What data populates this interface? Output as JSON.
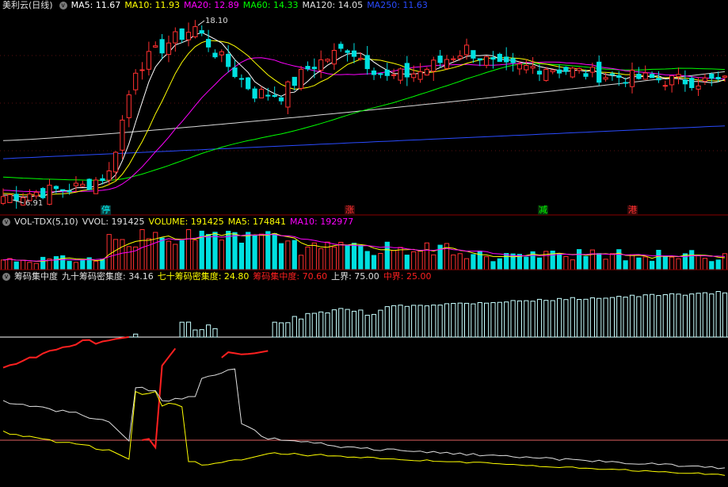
{
  "main_panel": {
    "title": "美利云(日线)",
    "indicators": [
      {
        "label": "MA5: 11.67",
        "color": "#ffffff"
      },
      {
        "label": "MA10: 11.93",
        "color": "#ffff00"
      },
      {
        "label": "MA20: 12.89",
        "color": "#ff00ff"
      },
      {
        "label": "MA60: 14.33",
        "color": "#00ff00"
      },
      {
        "label": "MA120: 14.05",
        "color": "#e0e0e0"
      },
      {
        "label": "MA250: 11.63",
        "color": "#2a4bff"
      }
    ],
    "high_label": "18.10",
    "low_label": "6.91",
    "events": [
      {
        "label": "停",
        "color": "#00ffff"
      },
      {
        "label": "涨",
        "color": "#ff3030"
      },
      {
        "label": "减",
        "color": "#00ff00"
      },
      {
        "label": "港",
        "color": "#ff3030"
      }
    ]
  },
  "volume_panel": {
    "title": "VOL-TDX(5,10)",
    "indicators": [
      {
        "label": "VVOL: 191425",
        "color": "#e0e0e0"
      },
      {
        "label": "VOLUME: 191425",
        "color": "#ffff00"
      },
      {
        "label": "MA5: 174841",
        "color": "#ffff00"
      },
      {
        "label": "MA10: 192977",
        "color": "#ff00ff"
      }
    ]
  },
  "chip_panel": {
    "title": "筹码集中度",
    "indicators": [
      {
        "label": "九十筹码密集度: 34.16",
        "color": "#e0e0e0"
      },
      {
        "label": "七十筹码密集度: 24.80",
        "color": "#ffff00"
      },
      {
        "label": "筹码集中度: 70.60",
        "color": "#ff2020"
      },
      {
        "label": "上界: 75.00",
        "color": "#e0e0e0"
      },
      {
        "label": "中界: 25.00",
        "color": "#ff2020"
      }
    ]
  },
  "colors": {
    "up": "#ff3030",
    "down": "#00e0e0",
    "ma5": "#ffffff",
    "ma10": "#ffff00",
    "ma20": "#ff00ff",
    "ma60": "#00ff00",
    "ma120": "#d8d8d8",
    "ma250": "#2a4bff"
  },
  "chart_data": {
    "type": "candlestick",
    "stock": "美利云",
    "period": "日线",
    "price_extremes": {
      "high": 18.1,
      "low": 6.91
    },
    "bars": 110,
    "close_trend_keypoints": [
      {
        "bar": 0,
        "close": 7.2
      },
      {
        "bar": 12,
        "close": 7.8
      },
      {
        "bar": 16,
        "close": 8.6
      },
      {
        "bar": 20,
        "close": 15.0
      },
      {
        "bar": 25,
        "close": 16.6
      },
      {
        "bar": 29,
        "close": 17.5
      },
      {
        "bar": 32,
        "close": 16.0
      },
      {
        "bar": 38,
        "close": 13.5
      },
      {
        "bar": 42,
        "close": 13.4
      },
      {
        "bar": 46,
        "close": 15.0
      },
      {
        "bar": 52,
        "close": 16.3
      },
      {
        "bar": 58,
        "close": 14.4
      },
      {
        "bar": 63,
        "close": 14.8
      },
      {
        "bar": 70,
        "close": 16.2
      },
      {
        "bar": 75,
        "close": 15.0
      },
      {
        "bar": 82,
        "close": 15.1
      },
      {
        "bar": 90,
        "close": 14.6
      },
      {
        "bar": 100,
        "close": 14.3
      },
      {
        "bar": 109,
        "close": 14.2
      }
    ],
    "chip_levels": {
      "upper": 75.0,
      "middle": 25.0
    },
    "latest": {
      "ma5": 11.67,
      "ma10": 11.93,
      "ma20": 12.89,
      "ma60": 14.33,
      "ma120": 14.05,
      "ma250": 11.63,
      "vvol": 191425,
      "volume": 191425,
      "vol_ma5": 174841,
      "vol_ma10": 192977,
      "chip90": 34.16,
      "chip70": 24.8,
      "chip_concentration": 70.6
    }
  }
}
